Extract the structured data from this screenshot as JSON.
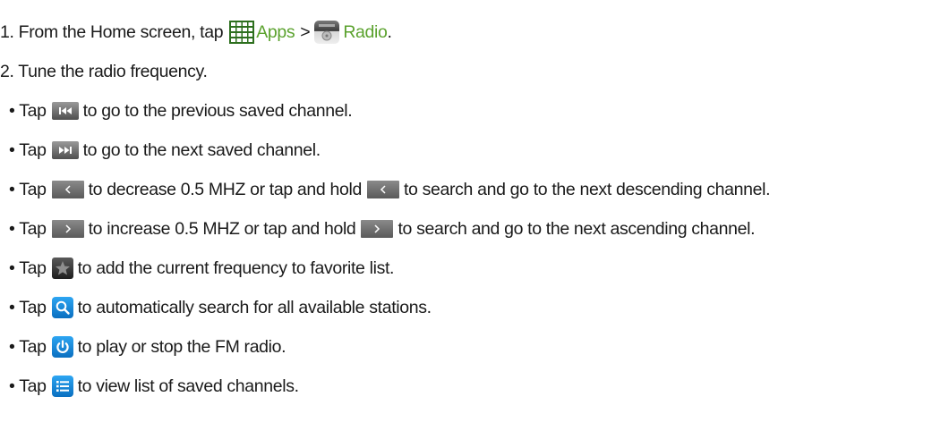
{
  "step1": {
    "prefix": "1. From the Home screen, tap",
    "apps_icon": "apps-grid-icon",
    "apps_label": "Apps",
    "separator": ">",
    "radio_icon": "fm-radio-app-icon",
    "radio_label": "Radio",
    "end": "."
  },
  "step2": {
    "text": "2. Tune the radio frequency."
  },
  "bullets": [
    {
      "icon": "previous-channel-icon",
      "before": "• Tap",
      "after": "to go to the previous saved channel."
    },
    {
      "icon": "next-channel-icon",
      "before": "• Tap",
      "after": "to go to the next saved channel."
    },
    {
      "icon": "decrease-frequency-icon",
      "before": "• Tap",
      "middle": "to decrease 0.5 MHZ or tap and hold",
      "after": "to search and go to the next descending channel."
    },
    {
      "icon": "increase-frequency-icon",
      "before": "• Tap",
      "middle": "to increase 0.5 MHZ or tap and hold",
      "after": "to search and go to the next ascending channel."
    },
    {
      "icon": "favorite-star-icon",
      "before": "• Tap",
      "after": "to add the current frequency to favorite list."
    },
    {
      "icon": "search-icon",
      "before": "• Tap",
      "after": "to automatically search for all available stations."
    },
    {
      "icon": "power-icon",
      "before": "• Tap",
      "after": "to play or stop the FM radio."
    },
    {
      "icon": "channel-list-icon",
      "before": "• Tap",
      "after": "to view list of saved channels."
    }
  ],
  "colors": {
    "link_green": "#5ba22e",
    "text": "#1a1a1a",
    "icon_blue": "#1a8ae0"
  }
}
